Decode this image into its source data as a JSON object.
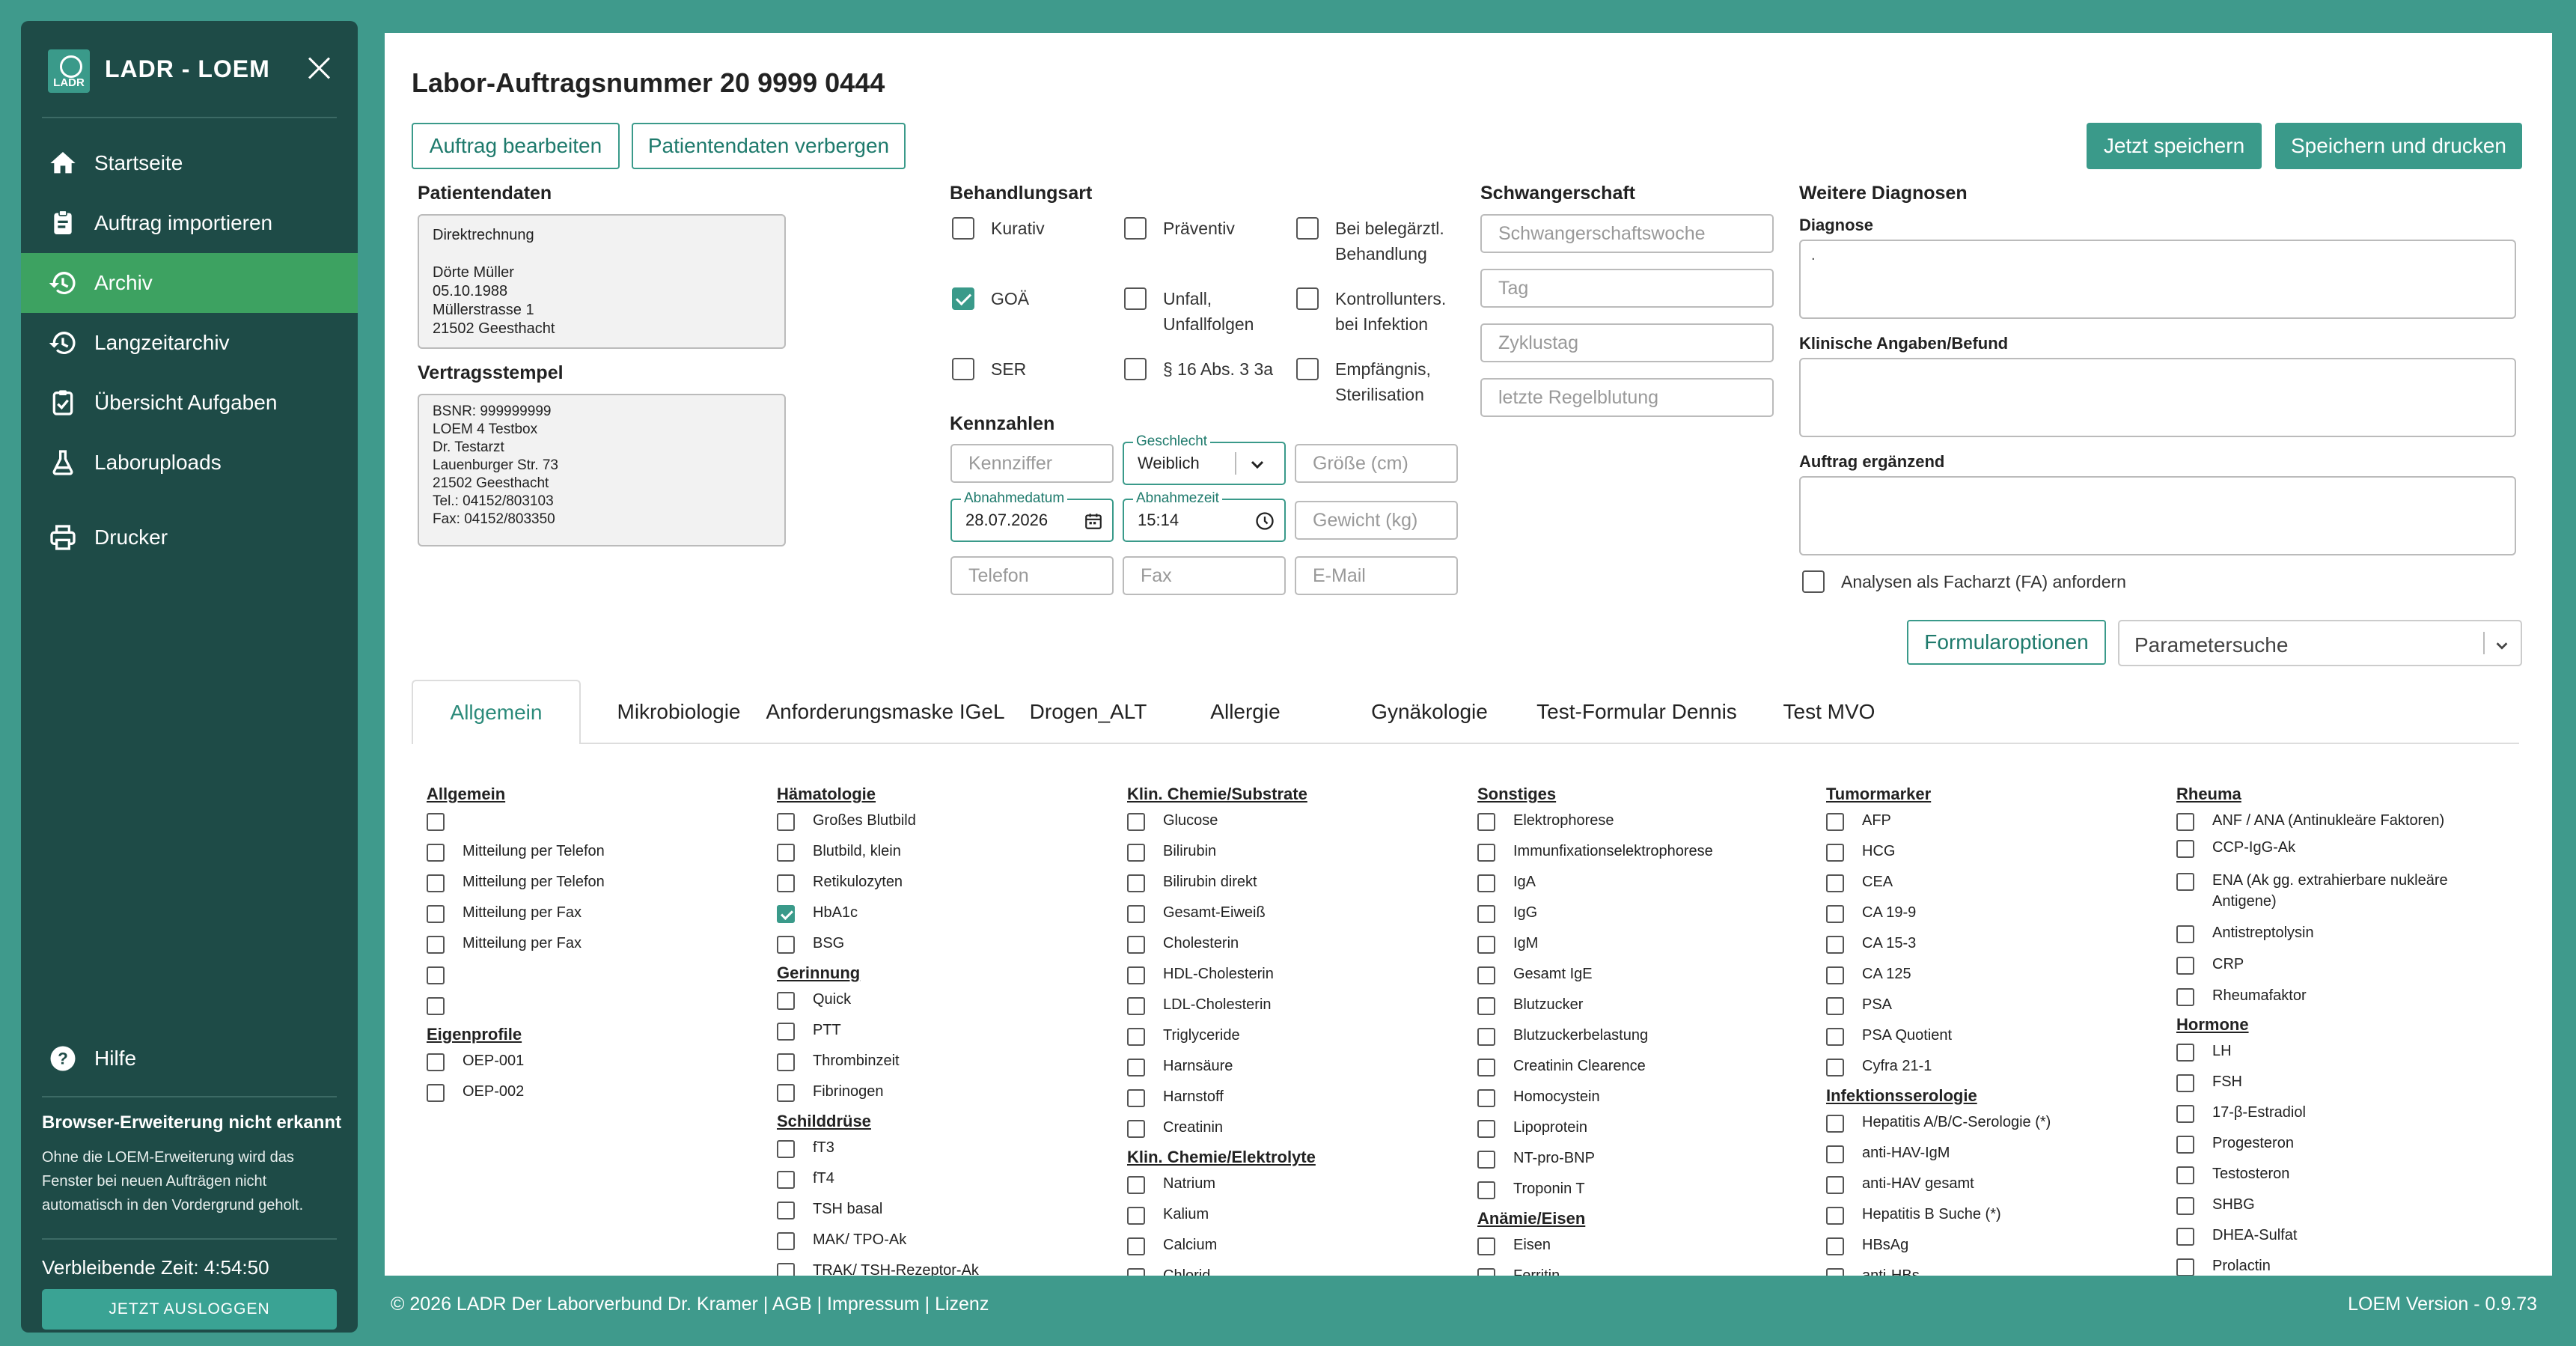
{
  "sidebar": {
    "title": "LADR - LOEM",
    "logo_text": "LADR",
    "nav": [
      {
        "label": "Startseite",
        "icon": "home-icon"
      },
      {
        "label": "Auftrag importieren",
        "icon": "clipboard-icon"
      },
      {
        "label": "Archiv",
        "icon": "history-icon"
      },
      {
        "label": "Langzeitarchiv",
        "icon": "history-icon"
      },
      {
        "label": "Übersicht Aufgaben",
        "icon": "clipboard-check-icon"
      },
      {
        "label": "Laboruploads",
        "icon": "flask-icon"
      },
      {
        "label": "Drucker",
        "icon": "printer-icon"
      }
    ],
    "help": "Hilfe",
    "extension_title": "Browser-Erweiterung nicht erkannt",
    "extension_text": "Ohne die LOEM-Erweiterung wird das Fenster bei neuen Aufträgen nicht automatisch in den Vordergrund geholt.",
    "remaining_time": "Verbleibende Zeit: 4:54:50",
    "logout": "JETZT AUSLOGGEN"
  },
  "header": {
    "title": "Labor-Auftragsnummer 20 9999 0444",
    "edit_btn": "Auftrag bearbeiten",
    "hide_btn": "Patientendaten verbergen",
    "save_btn": "Jetzt speichern",
    "save_print_btn": "Speichern und drucken"
  },
  "patient": {
    "label": "Patientendaten",
    "text": "Direktrechnung\n\nDörte Müller\n05.10.1988\nMüllerstrasse 1\n21502 Geesthacht",
    "stamp_label": "Vertragsstempel",
    "stamp": "BSNR: 999999999\nLOEM 4 Testbox\nDr. Testarzt\nLauenburger Str. 73\n21502 Geesthacht\nTel.: 04152/803103\nFax: 04152/803350"
  },
  "treatment": {
    "label": "Behandlungsart",
    "options": [
      {
        "label": "Kurativ",
        "checked": false
      },
      {
        "label": "Präventiv",
        "checked": false
      },
      {
        "label": "Bei belegärztl. Behandlung",
        "checked": false
      },
      {
        "label": "GOÄ",
        "checked": true
      },
      {
        "label": "Unfall, Unfallfolgen",
        "checked": false
      },
      {
        "label": "Kontrollunters. bei Infektion",
        "checked": false
      },
      {
        "label": "SER",
        "checked": false
      },
      {
        "label": "§ 16 Abs. 3 3a",
        "checked": false
      },
      {
        "label": "Empfängnis, Sterilisation",
        "checked": false
      }
    ]
  },
  "kennzahlen": {
    "label": "Kennzahlen",
    "kennziffer": "Kennziffer",
    "geschlecht_label": "Geschlecht",
    "geschlecht": "Weiblich",
    "groesse": "Größe (cm)",
    "abnahmedatum_label": "Abnahmedatum",
    "abnahmedatum": "28.07.2026",
    "abnahmezeit_label": "Abnahmezeit",
    "abnahmezeit": "15:14",
    "gewicht": "Gewicht (kg)",
    "telefon": "Telefon",
    "fax": "Fax",
    "email": "E-Mail"
  },
  "pregnancy": {
    "label": "Schwangerschaft",
    "fields": [
      "Schwangerschaftswoche",
      "Tag",
      "Zyklustag",
      "letzte Regelblutung"
    ]
  },
  "diagnoses": {
    "label": "Weitere Diagnosen",
    "diagnose_label": "Diagnose",
    "diagnose_value": ".",
    "klinisch_label": "Klinische Angaben/Befund",
    "ergaenzend_label": "Auftrag ergänzend",
    "facharzt": "Analysen als Facharzt (FA) anfordern"
  },
  "options": {
    "formular_btn": "Formularoptionen",
    "param_search": "Parametersuche"
  },
  "tabs": [
    "Allgemein",
    "Mikrobiologie",
    "Anforderungsmaske IGeL",
    "Drogen_ALT",
    "Allergie",
    "Gynäkologie",
    "Test-Formular Dennis",
    "Test MVO"
  ],
  "categories": {
    "allgemein": {
      "title": "Allgemein",
      "items": [
        {
          "label": "",
          "checked": false
        },
        {
          "label": "Mitteilung per Telefon",
          "checked": false
        },
        {
          "label": "Mitteilung per Telefon",
          "checked": false
        },
        {
          "label": "Mitteilung per Fax",
          "checked": false
        },
        {
          "label": "Mitteilung per Fax",
          "checked": false
        },
        {
          "label": "",
          "checked": false
        },
        {
          "label": "",
          "checked": false
        }
      ]
    },
    "eigenprofile": {
      "title": "Eigenprofile",
      "items": [
        {
          "label": "OEP-001",
          "checked": false
        },
        {
          "label": "OEP-002",
          "checked": false
        }
      ]
    },
    "haematologie": {
      "title": "Hämatologie",
      "items": [
        {
          "label": "Großes Blutbild",
          "checked": false
        },
        {
          "label": "Blutbild, klein",
          "checked": false
        },
        {
          "label": "Retikulozyten",
          "checked": false
        },
        {
          "label": "HbA1c",
          "checked": true
        },
        {
          "label": "BSG",
          "checked": false
        }
      ]
    },
    "gerinnung": {
      "title": "Gerinnung",
      "items": [
        {
          "label": "Quick",
          "checked": false
        },
        {
          "label": "PTT",
          "checked": false
        },
        {
          "label": "Thrombinzeit",
          "checked": false
        },
        {
          "label": "Fibrinogen",
          "checked": false
        }
      ]
    },
    "schilddruese": {
      "title": "Schilddrüse",
      "items": [
        {
          "label": "fT3",
          "checked": false
        },
        {
          "label": "fT4",
          "checked": false
        },
        {
          "label": "TSH basal",
          "checked": false
        },
        {
          "label": "MAK/ TPO-Ak",
          "checked": false
        },
        {
          "label": "TRAK/ TSH-Rezeptor-Ak",
          "checked": false
        }
      ]
    },
    "substrate": {
      "title": "Klin. Chemie/Substrate",
      "items": [
        {
          "label": "Glucose",
          "checked": false
        },
        {
          "label": "Bilirubin",
          "checked": false
        },
        {
          "label": "Bilirubin direkt",
          "checked": false
        },
        {
          "label": "Gesamt-Eiweiß",
          "checked": false
        },
        {
          "label": "Cholesterin",
          "checked": false
        },
        {
          "label": "HDL-Cholesterin",
          "checked": false
        },
        {
          "label": "LDL-Cholesterin",
          "checked": false
        },
        {
          "label": "Triglyceride",
          "checked": false
        },
        {
          "label": "Harnsäure",
          "checked": false
        },
        {
          "label": "Harnstoff",
          "checked": false
        },
        {
          "label": "Creatinin",
          "checked": false
        }
      ]
    },
    "elektrolyte": {
      "title": "Klin. Chemie/Elektrolyte",
      "items": [
        {
          "label": "Natrium",
          "checked": false
        },
        {
          "label": "Kalium",
          "checked": false
        },
        {
          "label": "Calcium",
          "checked": false
        },
        {
          "label": "Chlorid",
          "checked": false
        }
      ]
    },
    "sonstiges": {
      "title": "Sonstiges",
      "items": [
        {
          "label": "Elektrophorese",
          "checked": false
        },
        {
          "label": "Immunfixationselektrophorese",
          "checked": false
        },
        {
          "label": "IgA",
          "checked": false
        },
        {
          "label": "IgG",
          "checked": false
        },
        {
          "label": "IgM",
          "checked": false
        },
        {
          "label": "Gesamt IgE",
          "checked": false
        },
        {
          "label": "Blutzucker",
          "checked": false
        },
        {
          "label": "Blutzuckerbelastung",
          "checked": false
        },
        {
          "label": "Creatinin Clearence",
          "checked": false
        },
        {
          "label": "Homocystein",
          "checked": false
        },
        {
          "label": "Lipoprotein",
          "checked": false
        },
        {
          "label": "NT-pro-BNP",
          "checked": false
        },
        {
          "label": "Troponin T",
          "checked": false
        }
      ]
    },
    "anaemie": {
      "title": "Anämie/Eisen",
      "items": [
        {
          "label": "Eisen",
          "checked": false
        },
        {
          "label": "Ferritin",
          "checked": false
        }
      ]
    },
    "tumormarker": {
      "title": "Tumormarker",
      "items": [
        {
          "label": "AFP",
          "checked": false
        },
        {
          "label": "HCG",
          "checked": false
        },
        {
          "label": "CEA",
          "checked": false
        },
        {
          "label": "CA 19-9",
          "checked": false
        },
        {
          "label": "CA 15-3",
          "checked": false
        },
        {
          "label": "CA 125",
          "checked": false
        },
        {
          "label": "PSA",
          "checked": false
        },
        {
          "label": "PSA Quotient",
          "checked": false
        },
        {
          "label": "Cyfra 21-1",
          "checked": false
        }
      ]
    },
    "infektion": {
      "title": "Infektionsserologie",
      "items": [
        {
          "label": "Hepatitis A/B/C-Serologie (*)",
          "checked": false
        },
        {
          "label": "anti-HAV-IgM",
          "checked": false
        },
        {
          "label": "anti-HAV gesamt",
          "checked": false
        },
        {
          "label": "Hepatitis B Suche (*)",
          "checked": false
        },
        {
          "label": "HBsAg",
          "checked": false
        },
        {
          "label": "anti-HBs",
          "checked": false
        }
      ]
    },
    "rheuma": {
      "title": "Rheuma",
      "items": [
        {
          "label": "ANF / ANA (Antinukleäre Faktoren)",
          "checked": false
        },
        {
          "label": "CCP-IgG-Ak",
          "checked": false
        },
        {
          "label": "ENA (Ak gg. extrahierbare nukleäre Antigene)",
          "checked": false
        },
        {
          "label": "Antistreptolysin",
          "checked": false
        },
        {
          "label": "CRP",
          "checked": false
        },
        {
          "label": "Rheumafaktor",
          "checked": false
        }
      ]
    },
    "hormone": {
      "title": "Hormone",
      "items": [
        {
          "label": "LH",
          "checked": false
        },
        {
          "label": "FSH",
          "checked": false
        },
        {
          "label": "17-β-Estradiol",
          "checked": false
        },
        {
          "label": "Progesteron",
          "checked": false
        },
        {
          "label": "Testosteron",
          "checked": false
        },
        {
          "label": "SHBG",
          "checked": false
        },
        {
          "label": "DHEA-Sulfat",
          "checked": false
        },
        {
          "label": "Prolactin",
          "checked": false
        }
      ]
    }
  },
  "footer": {
    "left": "© 2026 LADR Der Laborverbund Dr. Kramer | AGB | Impressum | Lizenz",
    "version": "LOEM Version - 0.9.73"
  },
  "colors": {
    "background": "#3f9a8c",
    "sidebar": "#1e4b47",
    "active": "#3da261",
    "accent": "#3a9a8a"
  }
}
